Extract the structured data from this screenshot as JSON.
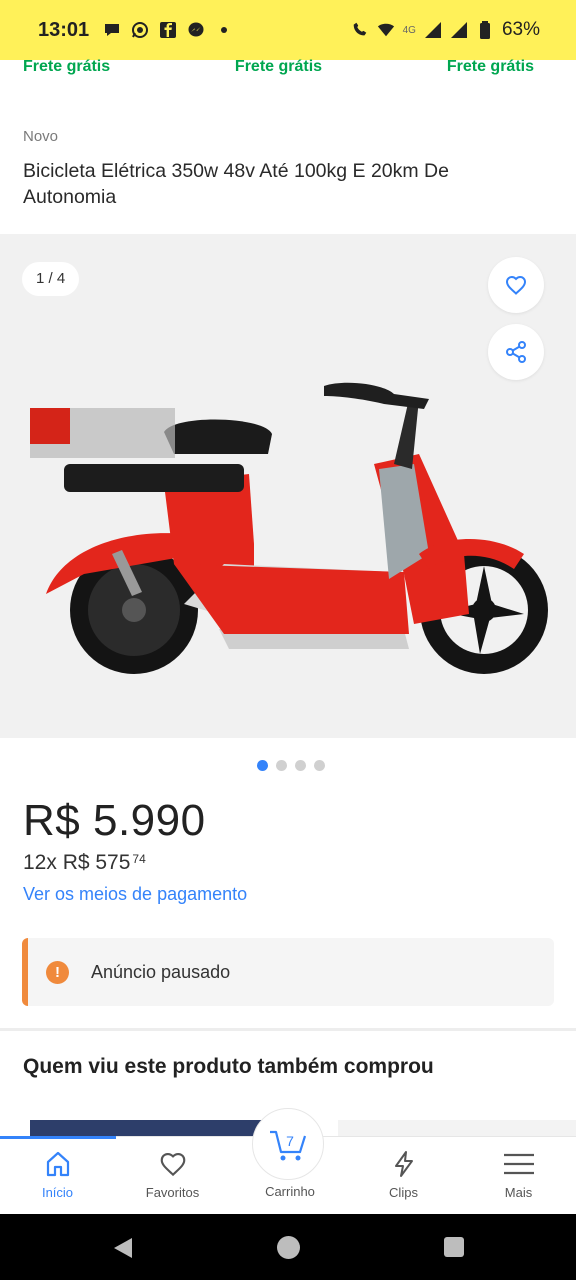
{
  "status_bar": {
    "time": "13:01",
    "battery": "63%",
    "network": "4G",
    "colors": {
      "background": "#fff159"
    },
    "icons": [
      "chat-icon",
      "whatsapp-icon",
      "facebook-icon",
      "messenger-icon",
      "dot-icon",
      "call-wifi-icon",
      "wifi-icon",
      "signal-icon",
      "battery-icon"
    ]
  },
  "shipping_labels": [
    "Frete grátis",
    "Frete grátis",
    "Frete grátis"
  ],
  "product": {
    "condition": "Novo",
    "title": "Bicicleta Elétrica 350w 48v Até 100kg E 20km De Autonomia"
  },
  "gallery": {
    "counter": "1 / 4",
    "image": "red-electric-scooter",
    "dots_total": 4,
    "dots_active_index": 0
  },
  "price": {
    "main": "R$ 5.990",
    "installments_prefix": "12x R$ 575",
    "installments_cents": "74",
    "payment_link": "Ver os meios de pagamento"
  },
  "notice": {
    "text": "Anúncio pausado",
    "color": "#f08a3c"
  },
  "section": {
    "title": "Quem viu este produto também comprou"
  },
  "bottom_nav": {
    "items": [
      {
        "label": "Início",
        "icon": "home-icon",
        "active": true
      },
      {
        "label": "Favoritos",
        "icon": "heart-icon",
        "active": false
      },
      {
        "label": "Carrinho",
        "icon": "cart-icon",
        "active": false,
        "badge": "7"
      },
      {
        "label": "Clips",
        "icon": "lightning-icon",
        "active": false
      },
      {
        "label": "Mais",
        "icon": "menu-icon",
        "active": false
      }
    ],
    "accent": "#3483fa"
  },
  "system_nav": {
    "icons": [
      "back-icon",
      "home-button-icon",
      "recents-icon"
    ]
  }
}
